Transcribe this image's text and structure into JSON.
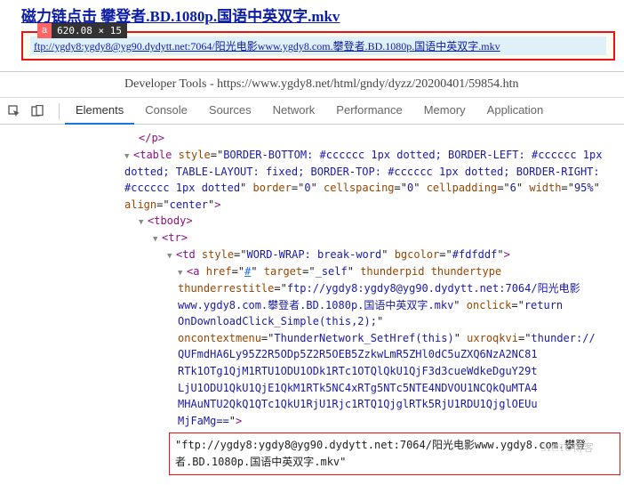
{
  "top": {
    "link_title": "磁力链点击 攀登者.BD.1080p.国语中英双字.mkv",
    "badge_a": "a",
    "badge_dim": "620.08 × 15",
    "ftp_url": "ftp://ygdy8:ygdy8@yg90.dydytt.net:7064/阳光电影www.ygdy8.com.攀登者.BD.1080p.国语中英双字.mkv"
  },
  "dev": {
    "window_title": "Developer Tools - https://www.ygdy8.net/html/gndy/dyzz/20200401/59854.htn",
    "tabs": [
      "Elements",
      "Console",
      "Sources",
      "Network",
      "Performance",
      "Memory",
      "Application"
    ]
  },
  "dom": {
    "close_p": "</p>",
    "table_open": "<table style=\"BORDER-BOTTOM: #cccccc 1px dotted; BORDER-LEFT: #cccccc 1px dotted; TABLE-LAYOUT: fixed; BORDER-TOP: #cccccc 1px dotted; BORDER-RIGHT: #cccccc 1px dotted\" border=\"0\" cellspacing=\"0\" cellpadding=\"6\" width=\"95%\" align=\"center\">",
    "tbody": "<tbody>",
    "tr": "<tr>",
    "td": "<td style=\"WORD-WRAP: break-word\" bgcolor=\"#fdfddf\">",
    "a_attrs": {
      "href": "#",
      "target": "_self",
      "thunderpid": "thunderpid",
      "thundertype": "thundertype",
      "thunderrestitle": "ftp://ygdy8:ygdy8@yg90.dydytt.net:7064/阳光电影www.ygdy8.com.攀登者.BD.1080p.国语中英双字.mkv",
      "onclick": "return OnDownloadClick_Simple(this,2);",
      "oncontextmenu": "ThunderNetwork_SetHref(this)",
      "uxroqkvi": "thunder://QUFmdHA6Ly95Z2R5ODp5Z2R5OEB5ZzkwLmR5ZHl0dC5uZXQ6NzA2NC81RTk1OTg1QjM1RTU1ODU1ODk1RTc1OTQ1QjU1QkU1QjF3d3cueWdkeDguY29tLjU1ODU1QkU1QjE1QkM1RTk5NC4xRTg5NTc5NTE4NDVOU1NCQkQuMTA4MHAuNTU2QkQ1QTc1QkU1RjU1Rjc1RTQ1QjglRTk5RjU1RDU1QjglOEUuMjFaMg==",
      "close": ">"
    },
    "text_node": "\"ftp://ygdy8:ygdy8@yg90.dydytt.net:7064/阳光电影www.ygdy8.com.攀登者.BD.1080p.国语中英双字.mkv\"",
    "watermark": "51CTO博客"
  }
}
